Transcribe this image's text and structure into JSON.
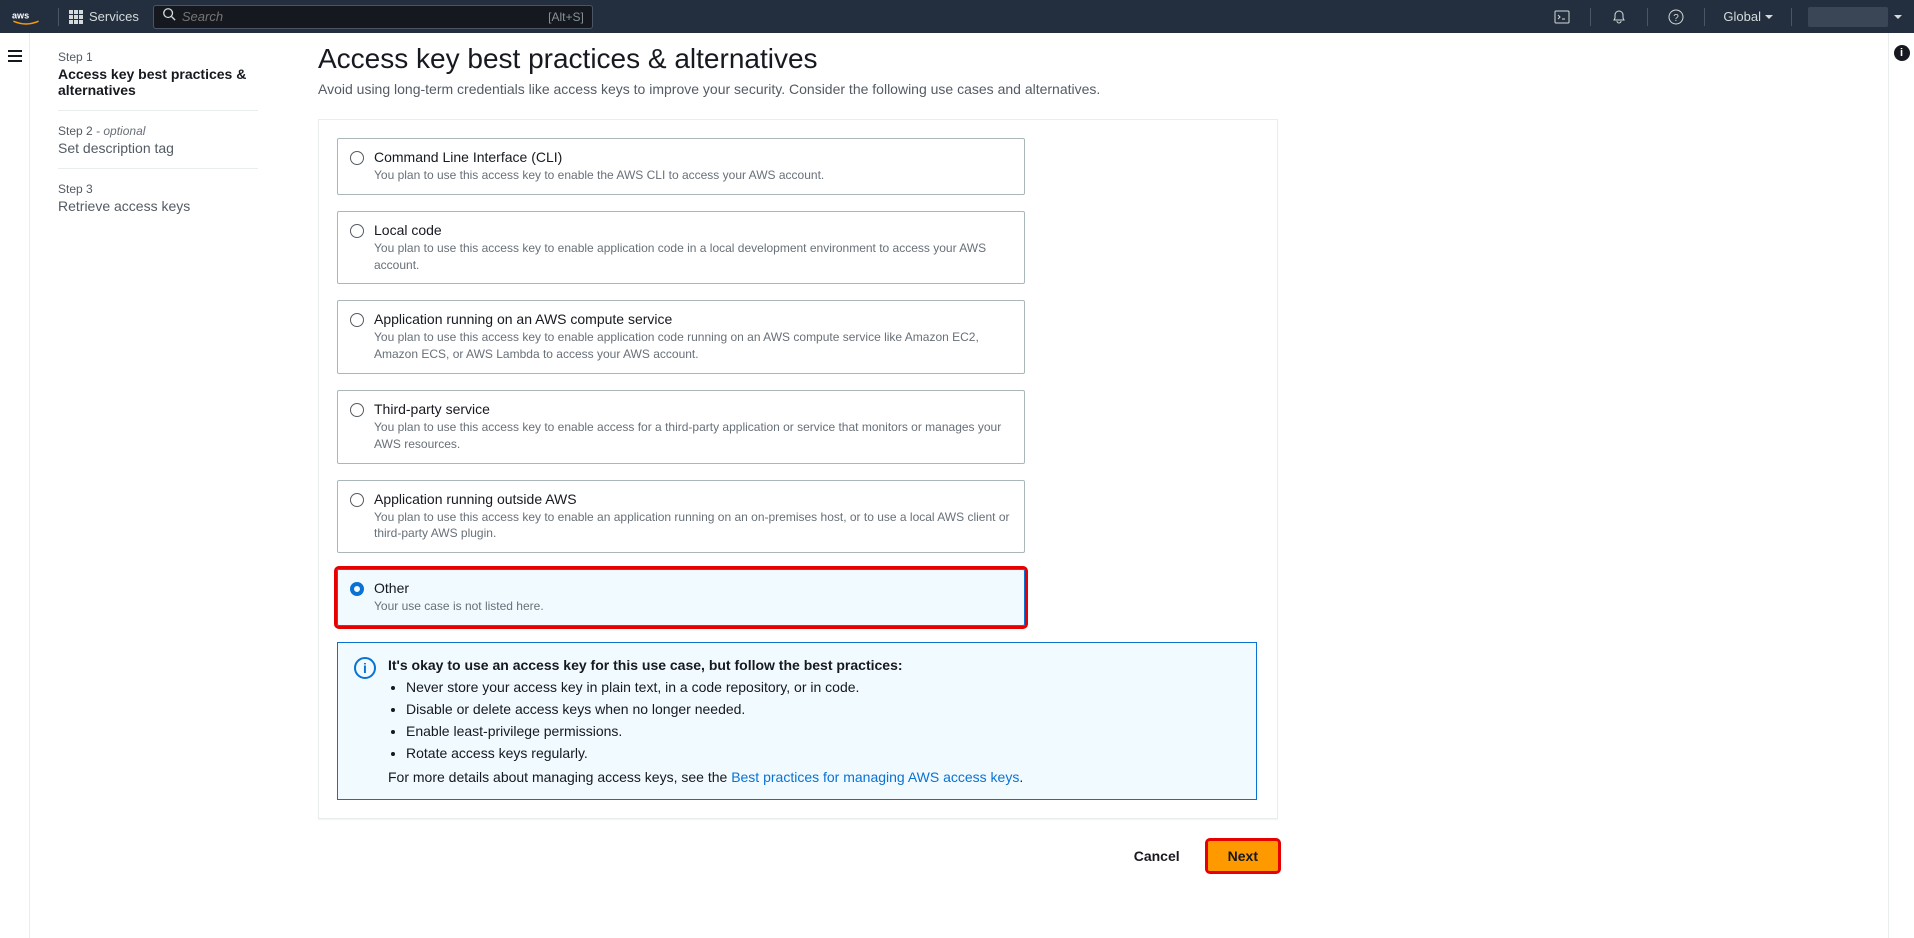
{
  "nav": {
    "services": "Services",
    "search_placeholder": "Search",
    "search_hint": "[Alt+S]",
    "region": "Global"
  },
  "steps": [
    {
      "num": "Step 1",
      "title": "Access key best practices & alternatives",
      "optional": ""
    },
    {
      "num": "Step 2",
      "title": "Set description tag",
      "optional": " - optional"
    },
    {
      "num": "Step 3",
      "title": "Retrieve access keys",
      "optional": ""
    }
  ],
  "page": {
    "title": "Access key best practices & alternatives",
    "desc": "Avoid using long-term credentials like access keys to improve your security. Consider the following use cases and alternatives."
  },
  "options": [
    {
      "title": "Command Line Interface (CLI)",
      "desc": "You plan to use this access key to enable the AWS CLI to access your AWS account."
    },
    {
      "title": "Local code",
      "desc": "You plan to use this access key to enable application code in a local development environment to access your AWS account."
    },
    {
      "title": "Application running on an AWS compute service",
      "desc": "You plan to use this access key to enable application code running on an AWS compute service like Amazon EC2, Amazon ECS, or AWS Lambda to access your AWS account."
    },
    {
      "title": "Third-party service",
      "desc": "You plan to use this access key to enable access for a third-party application or service that monitors or manages your AWS resources."
    },
    {
      "title": "Application running outside AWS",
      "desc": "You plan to use this access key to enable an application running on an on-premises host, or to use a local AWS client or third-party AWS plugin."
    },
    {
      "title": "Other",
      "desc": "Your use case is not listed here."
    }
  ],
  "banner": {
    "title": "It's okay to use an access key for this use case, but follow the best practices:",
    "bullets": [
      "Never store your access key in plain text, in a code repository, or in code.",
      "Disable or delete access keys when no longer needed.",
      "Enable least-privilege permissions.",
      "Rotate access keys regularly."
    ],
    "footer_pre": "For more details about managing access keys, see the ",
    "footer_link": "Best practices for managing AWS access keys",
    "footer_post": "."
  },
  "buttons": {
    "cancel": "Cancel",
    "next": "Next"
  }
}
